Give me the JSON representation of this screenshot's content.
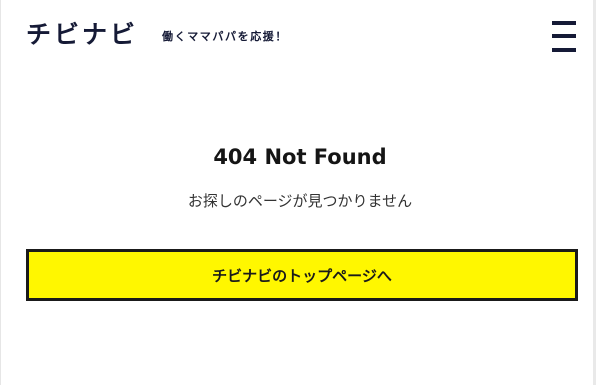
{
  "header": {
    "logo_text": "チビナビ",
    "tagline": "働くママパパを応援！",
    "menu_icon": "hamburger-menu-icon"
  },
  "main": {
    "title": "404 Not Found",
    "message": "お探しのページが見つかりません",
    "top_link_label": "チビナビのトップページへ"
  },
  "colors": {
    "brand_navy": "#151a36",
    "button_yellow": "#fff700",
    "button_border": "#1a1a1a"
  }
}
